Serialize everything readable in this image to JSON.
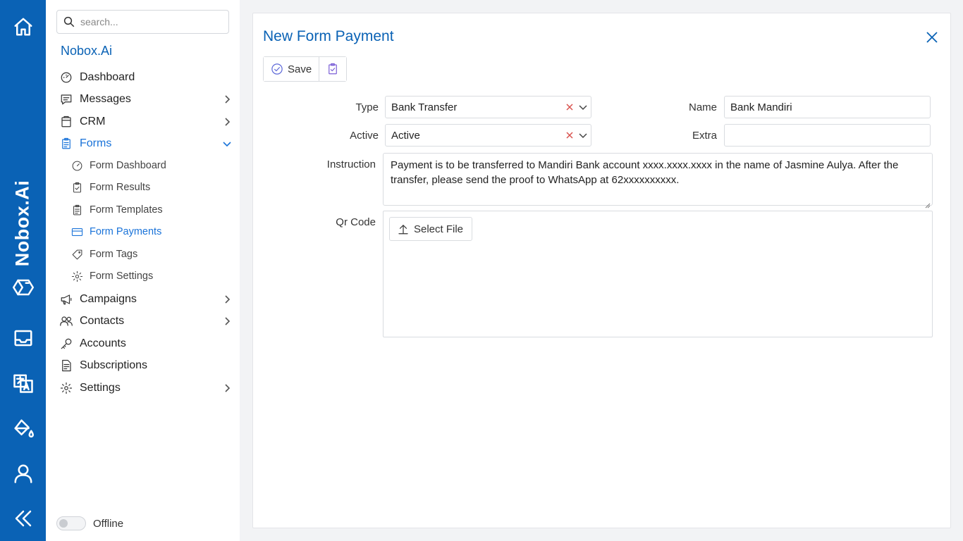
{
  "app": {
    "brand": "Nobox.Ai"
  },
  "rail": {
    "icons": [
      "home-icon",
      "nobox-logo-icon",
      "inbox-icon",
      "translate-icon",
      "paint-bucket-icon",
      "user-icon",
      "collapse-icon"
    ]
  },
  "sidebar": {
    "search_placeholder": "search...",
    "org_name": "Nobox.Ai",
    "items": [
      {
        "label": "Dashboard"
      },
      {
        "label": "Messages"
      },
      {
        "label": "CRM"
      },
      {
        "label": "Forms"
      },
      {
        "label": "Campaigns"
      },
      {
        "label": "Contacts"
      },
      {
        "label": "Accounts"
      },
      {
        "label": "Subscriptions"
      },
      {
        "label": "Settings"
      }
    ],
    "forms_sub": [
      {
        "label": "Form Dashboard"
      },
      {
        "label": "Form Results"
      },
      {
        "label": "Form Templates"
      },
      {
        "label": "Form Payments"
      },
      {
        "label": "Form Tags"
      },
      {
        "label": "Form Settings"
      }
    ],
    "status_label": "Offline",
    "status_on": false
  },
  "panel": {
    "title": "New Form Payment",
    "save_label": "Save",
    "fields": {
      "type_label": "Type",
      "type_value": "Bank Transfer",
      "name_label": "Name",
      "name_value": "Bank Mandiri",
      "active_label": "Active",
      "active_value": "Active",
      "extra_label": "Extra",
      "extra_value": "",
      "instruction_label": "Instruction",
      "instruction_value": "Payment is to be transferred to Mandiri Bank account xxxx.xxxx.xxxx in the name of Jasmine Aulya. After the transfer, please send the proof to WhatsApp at 62xxxxxxxxxx.",
      "qr_label": "Qr Code",
      "select_file_label": "Select File"
    }
  },
  "colors": {
    "accent": "#0a62b5",
    "active_link": "#1a73d9",
    "clear_x": "#d9534f"
  }
}
